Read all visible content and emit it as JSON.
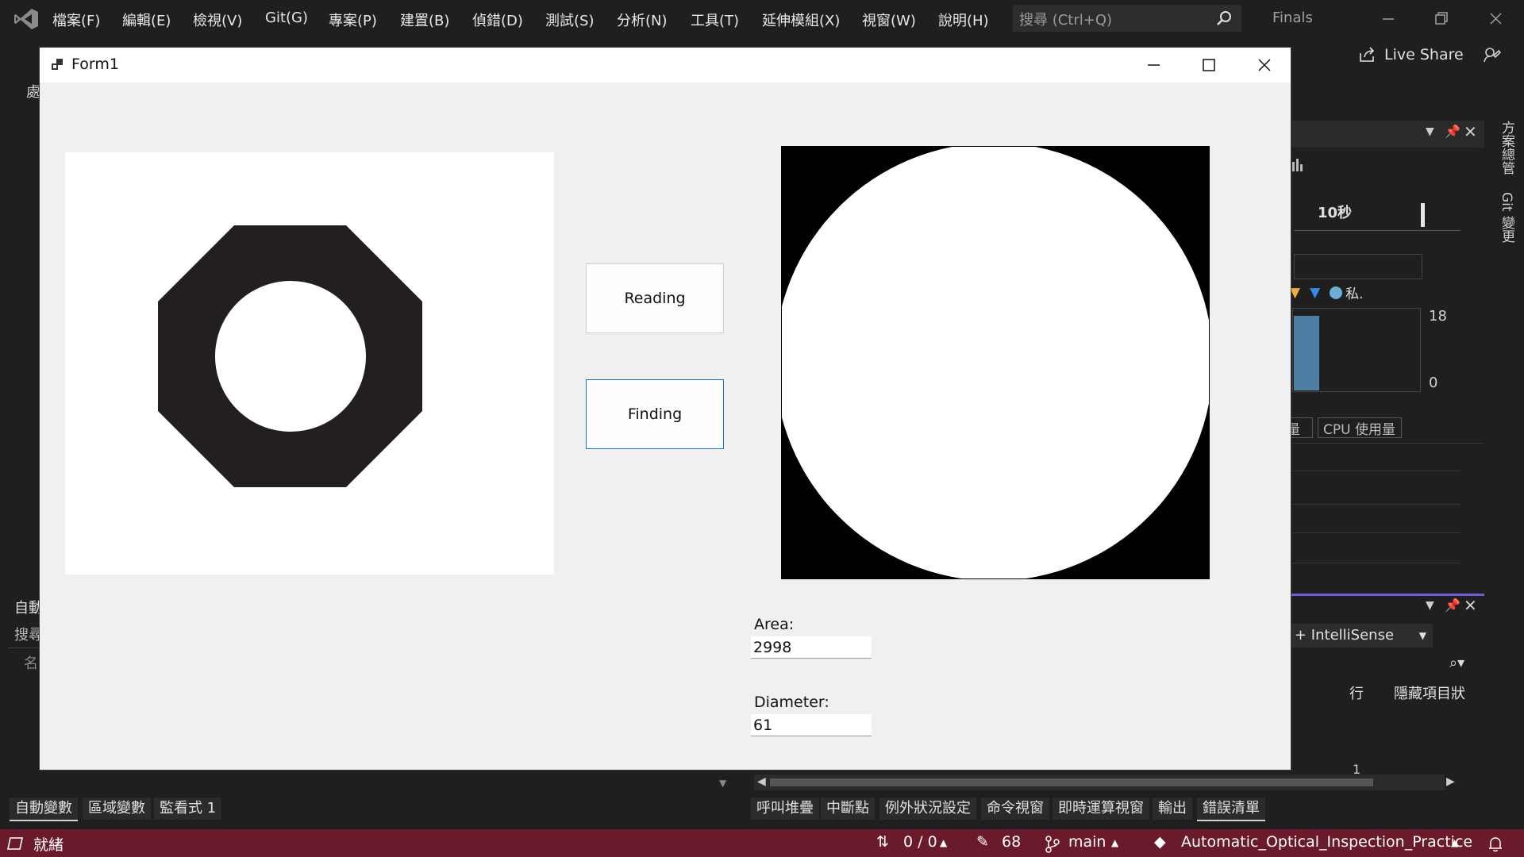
{
  "vs": {
    "menu": [
      "檔案(F)",
      "編輯(E)",
      "檢視(V)",
      "Git(G)",
      "專案(P)",
      "建置(B)",
      "偵錯(D)",
      "測試(S)",
      "分析(N)",
      "工具(T)",
      "延伸模組(X)",
      "視窗(W)",
      "說明(H)"
    ],
    "search_placeholder": "搜尋 (Ctrl+Q)",
    "solution_name": "Finals",
    "live_share": "Live Share",
    "side_tabs": [
      "方案總管",
      "Git 變更"
    ],
    "left_partial_label": "處",
    "diag": {
      "time_label": "10秒",
      "legend_private": "私.",
      "axis_max": "18",
      "axis_min": "0",
      "tab_memory": "量",
      "tab_cpu": "CPU 使用量"
    },
    "errors": {
      "intellisense_filter": "+ IntelliSense",
      "col_line": "行",
      "col_hidden": "隱藏項目狀",
      "row_line_value": "1"
    },
    "left_panel": {
      "title_partial": "自動",
      "search_partial": "搜尋",
      "name_partial": "名"
    },
    "bottom_tabs_left": [
      "自動變數",
      "區域變數",
      "監看式 1"
    ],
    "bottom_tabs_right": [
      "呼叫堆疊",
      "中斷點",
      "例外狀況設定",
      "命令視窗",
      "即時運算視窗",
      "輸出",
      "錯誤清單"
    ],
    "status": {
      "ready": "就緒",
      "updown": "0 / 0",
      "edits": "68",
      "branch": "main",
      "repo": "Automatic_Optical_Inspection_Practice"
    }
  },
  "form": {
    "title": "Form1",
    "btn_reading": "Reading",
    "btn_finding": "Finding",
    "area_label": "Area:",
    "area_value": "2998",
    "diameter_label": "Diameter:",
    "diameter_value": "61"
  }
}
